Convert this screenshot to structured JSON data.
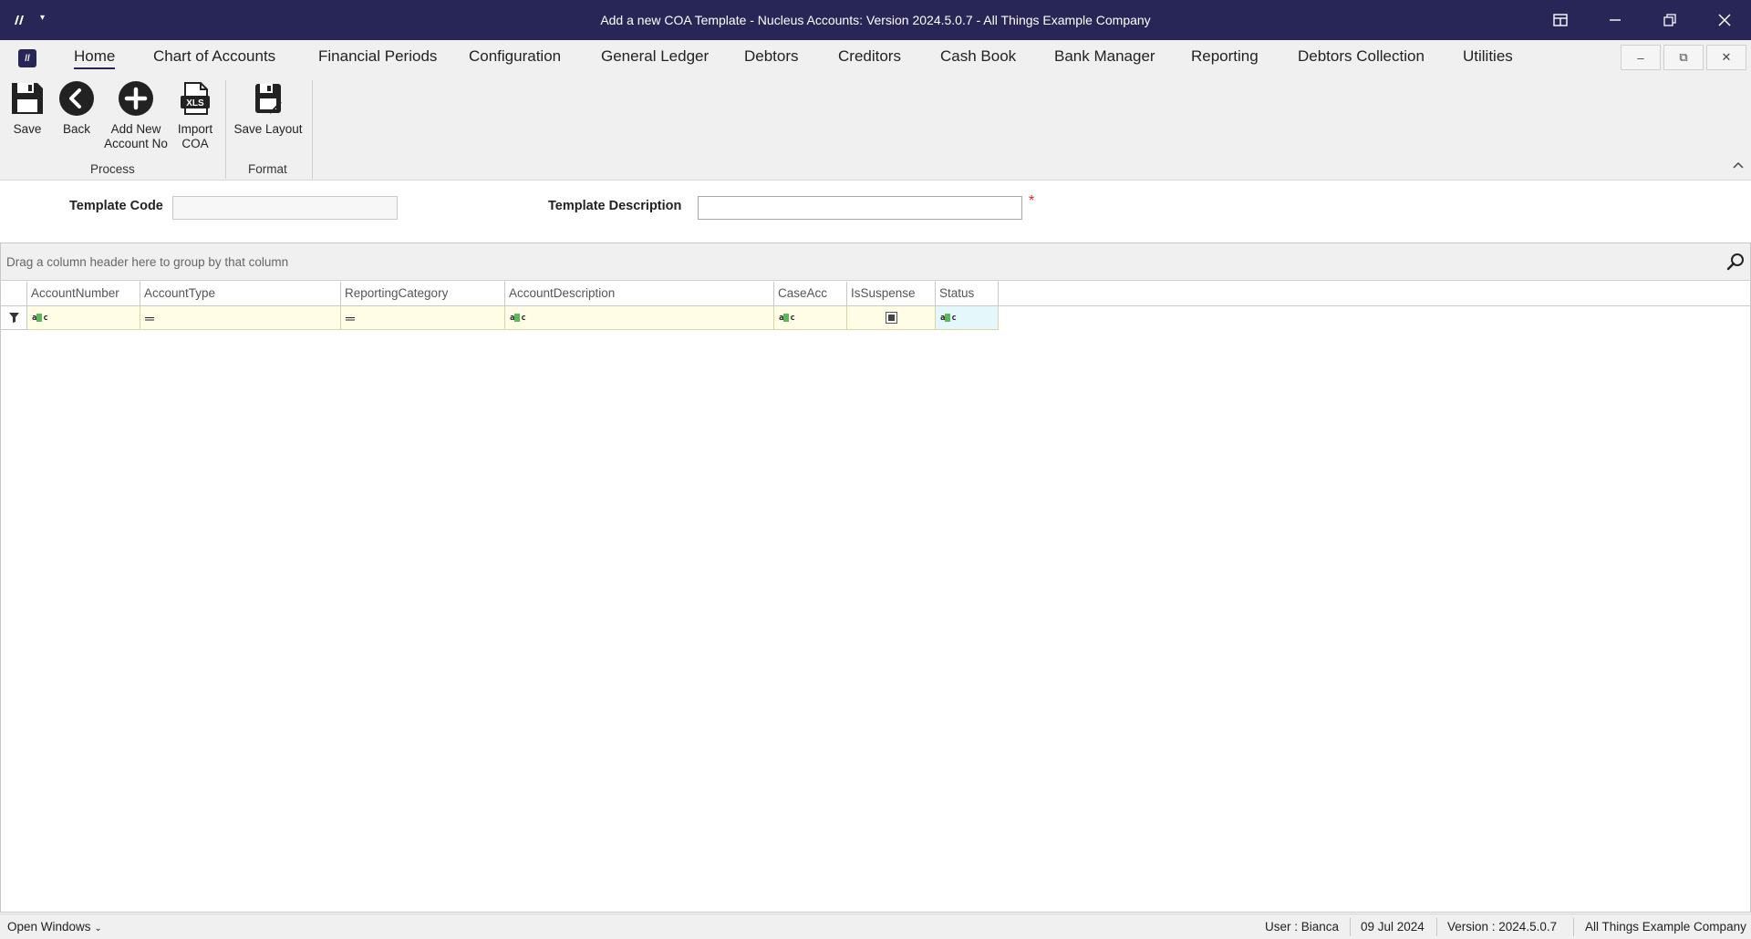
{
  "window": {
    "title": "Add a new COA Template - Nucleus Accounts: Version 2024.5.0.7 - All Things Example Company",
    "app_icon": "app-logo-icon",
    "controls": [
      "layout-icon",
      "minimize-icon",
      "restore-icon",
      "close-icon"
    ]
  },
  "menu": {
    "items": [
      {
        "label": "Home",
        "active": true
      },
      {
        "label": "Chart of Accounts"
      },
      {
        "label": "Financial Periods"
      },
      {
        "label": "Configuration"
      },
      {
        "label": "General Ledger"
      },
      {
        "label": "Debtors"
      },
      {
        "label": "Creditors"
      },
      {
        "label": "Cash Book"
      },
      {
        "label": "Bank Manager"
      },
      {
        "label": "Reporting"
      },
      {
        "label": "Debtors Collection"
      },
      {
        "label": "Utilities"
      }
    ]
  },
  "ribbon": {
    "buttons": [
      {
        "label": "Save",
        "icon": "save-icon"
      },
      {
        "label": "Back",
        "icon": "back-icon"
      },
      {
        "label": "Add New Account No",
        "line1": "Add New",
        "line2": "Account No",
        "icon": "add-icon"
      },
      {
        "label": "Import COA",
        "line1": "Import",
        "line2": "COA",
        "icon": "xls-import-icon"
      },
      {
        "label": "Save Layout",
        "icon": "save-layout-icon"
      }
    ],
    "groups": [
      {
        "label": "Process"
      },
      {
        "label": "Format"
      }
    ]
  },
  "form": {
    "template_code_label": "Template Code",
    "template_code_value": "",
    "template_description_label": "Template Description",
    "template_description_value": "",
    "required_marker": "*"
  },
  "grid": {
    "group_by_hint": "Drag a column header here to group by that column",
    "columns": [
      "AccountNumber",
      "AccountType",
      "ReportingCategory",
      "AccountDescription",
      "CaseAcc",
      "IsSuspense",
      "Status"
    ],
    "rows": []
  },
  "statusbar": {
    "open_windows": "Open Windows",
    "user": "User : Bianca",
    "date": "09 Jul 2024",
    "version": "Version : 2024.5.0.7",
    "company": "All Things Example Company"
  }
}
